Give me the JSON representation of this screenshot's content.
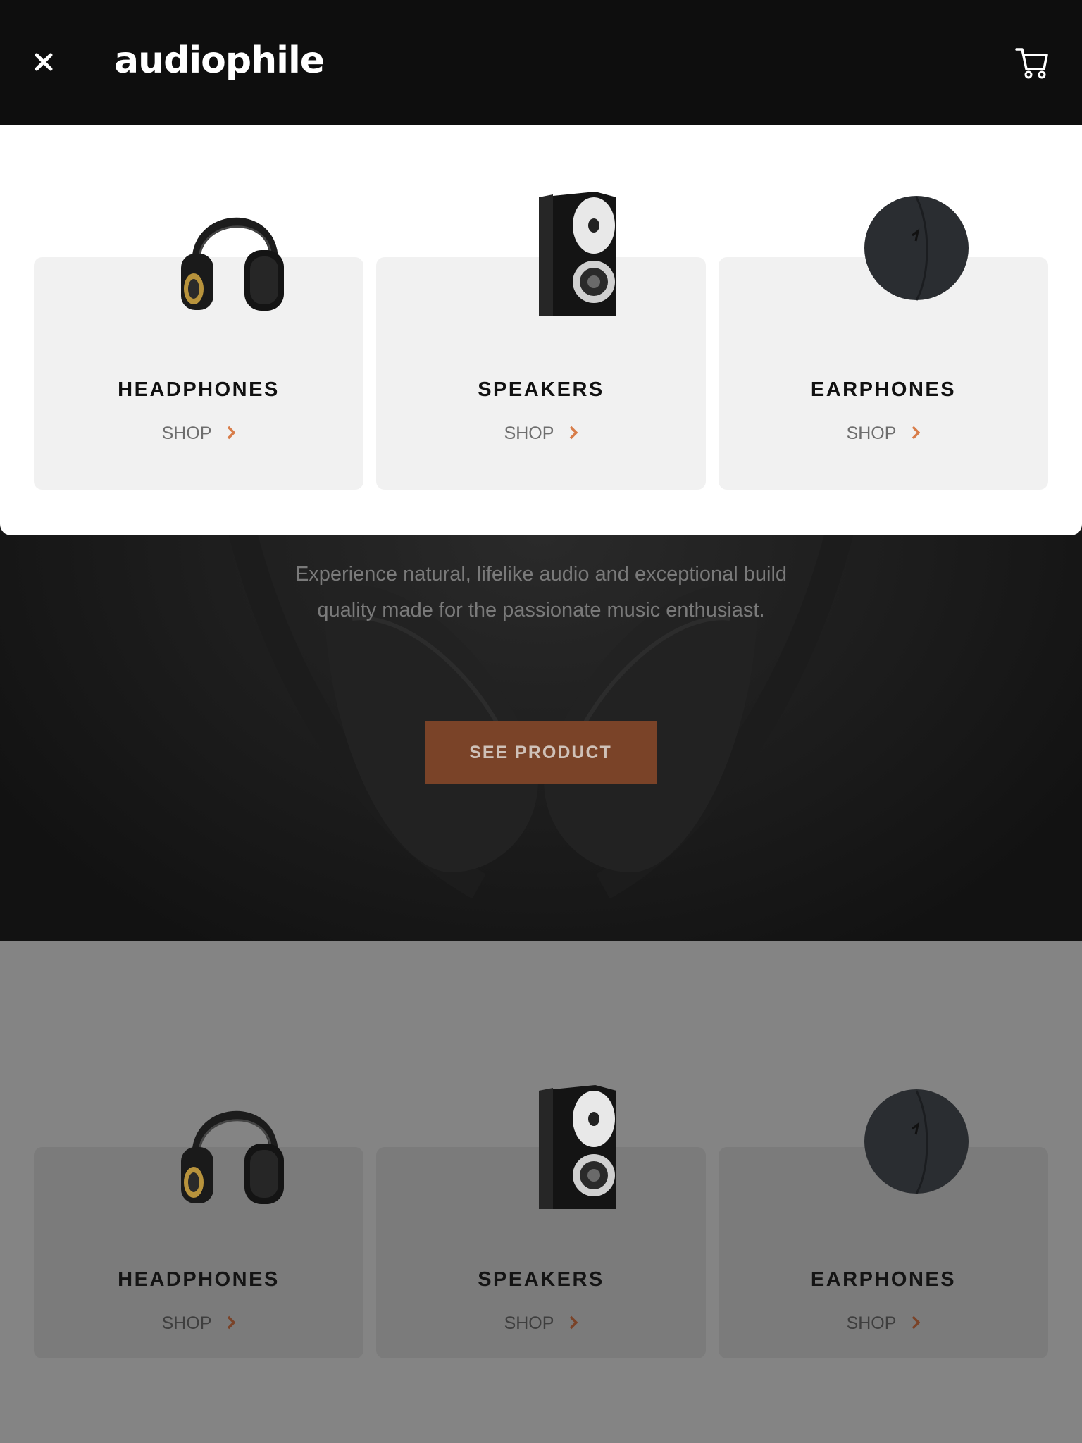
{
  "header": {
    "logo": "audiophile",
    "close_icon": "close-icon",
    "cart_icon": "cart-icon"
  },
  "menu": {
    "categories": [
      {
        "name": "HEADPHONES",
        "link": "SHOP",
        "icon": "headphones-image"
      },
      {
        "name": "SPEAKERS",
        "link": "SHOP",
        "icon": "speaker-image"
      },
      {
        "name": "EARPHONES",
        "link": "SHOP",
        "icon": "earphones-image"
      }
    ]
  },
  "hero": {
    "description": "Experience natural, lifelike audio and exceptional build quality made for the passionate music enthusiast.",
    "cta": "SEE PRODUCT"
  },
  "categories": [
    {
      "name": "HEADPHONES",
      "link": "SHOP"
    },
    {
      "name": "SPEAKERS",
      "link": "SHOP"
    },
    {
      "name": "EARPHONES",
      "link": "SHOP"
    }
  ],
  "colors": {
    "accent": "#D87D4A",
    "header_bg": "#0E0E0E",
    "card_bg": "#F1F1F1",
    "cta_bg": "#7A4328"
  }
}
